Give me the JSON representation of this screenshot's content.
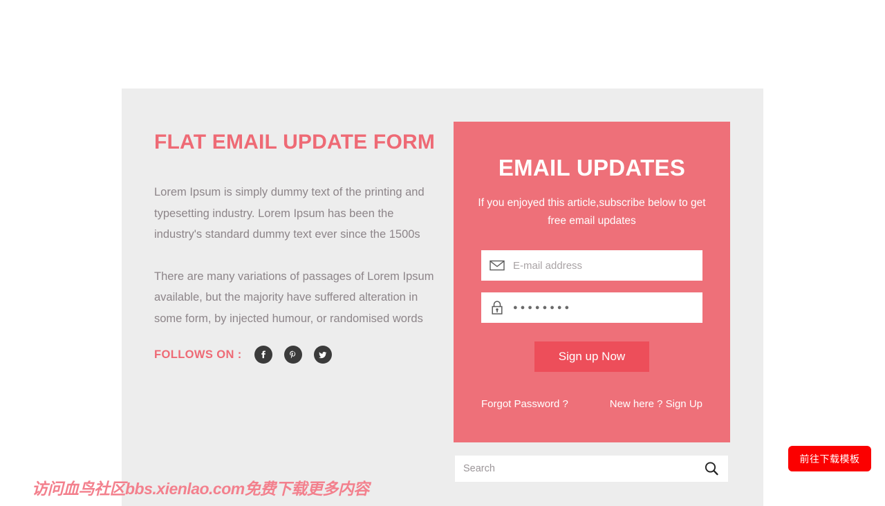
{
  "left": {
    "title": "FLAT EMAIL UPDATE FORM",
    "paragraph_1": "Lorem Ipsum is simply dummy text of the printing and typesetting industry. Lorem Ipsum has been the industry's standard dummy text ever since the 1500s",
    "paragraph_2": "There are many variations of passages of Lorem Ipsum available, but the majority have suffered alteration in some form, by injected humour, or randomised words",
    "follows_label": "FOLLOWS ON :",
    "socials": [
      {
        "name": "facebook-icon"
      },
      {
        "name": "pinterest-icon"
      },
      {
        "name": "twitter-icon"
      }
    ]
  },
  "panel": {
    "title": "EMAIL UPDATES",
    "subtitle": "If you enjoyed this article,subscribe below to get free email updates",
    "email_field": {
      "icon": "envelope-icon",
      "placeholder": "E-mail address",
      "value": ""
    },
    "password_field": {
      "icon": "lock-icon",
      "masked_value": "●●●●●●●●"
    },
    "signup_label": "Sign up Now",
    "forgot_label": "Forgot Password ?",
    "signup_link_label": "New here ? Sign Up"
  },
  "search": {
    "placeholder": "Search",
    "value": "",
    "icon": "search-icon"
  },
  "watermark": "访问血鸟社区bbs.xienlao.com免费下载更多内容",
  "float_button": {
    "label": "前往下载模板"
  },
  "colors": {
    "accent_pink": "#ee6a75",
    "panel_pink": "#ee7079",
    "button_red": "#ed4e5a",
    "card_bg": "#ededed",
    "body_text": "#8d8589",
    "float_button_red": "#fb0000",
    "social_dark": "#3b3b3b"
  }
}
